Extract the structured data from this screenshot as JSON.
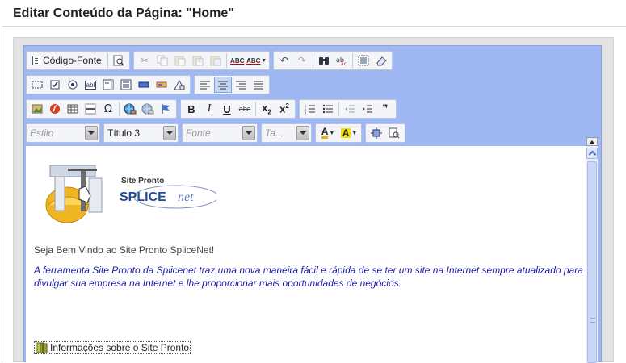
{
  "page": {
    "title": "Editar Conteúdo da Página: \"Home\""
  },
  "toolbar": {
    "source_label": "Código-Fonte",
    "style_combo": {
      "value": "Estilo"
    },
    "format_combo": {
      "value": "Título 3"
    },
    "font_combo": {
      "value": "Fonte"
    },
    "size_combo": {
      "value": "Ta..."
    },
    "active_alignment": "center",
    "bold": "B",
    "italic": "I",
    "underline": "U",
    "strike": "abc",
    "subscript_base": "x",
    "subscript_mark": "2",
    "superscript_base": "x",
    "superscript_mark": "2",
    "spellcheck": "ABC",
    "text_color": "A",
    "bg_color": "A",
    "omega": "Ω",
    "quote": "❞",
    "textfield": "abl"
  },
  "content": {
    "logo": {
      "top_text": "Site Pronto",
      "brand_a": "SPLICE",
      "brand_b": "net"
    },
    "welcome": "Seja Bem Vindo ao Site Pronto SpliceNet!",
    "description": "A ferramenta Site Pronto da Splicenet traz uma nova maneira fácil e rápida de se ter um site na Internet sempre atualizado para divulgar sua empresa na Internet e lhe proporcionar mais oportunidades de negócios.",
    "info_link": "Informações sobre o Site Pronto"
  },
  "colors": {
    "editor_bg": "#9fb7f2",
    "description_text": "#1a1aa0",
    "active_button": "#c5d8f7"
  }
}
